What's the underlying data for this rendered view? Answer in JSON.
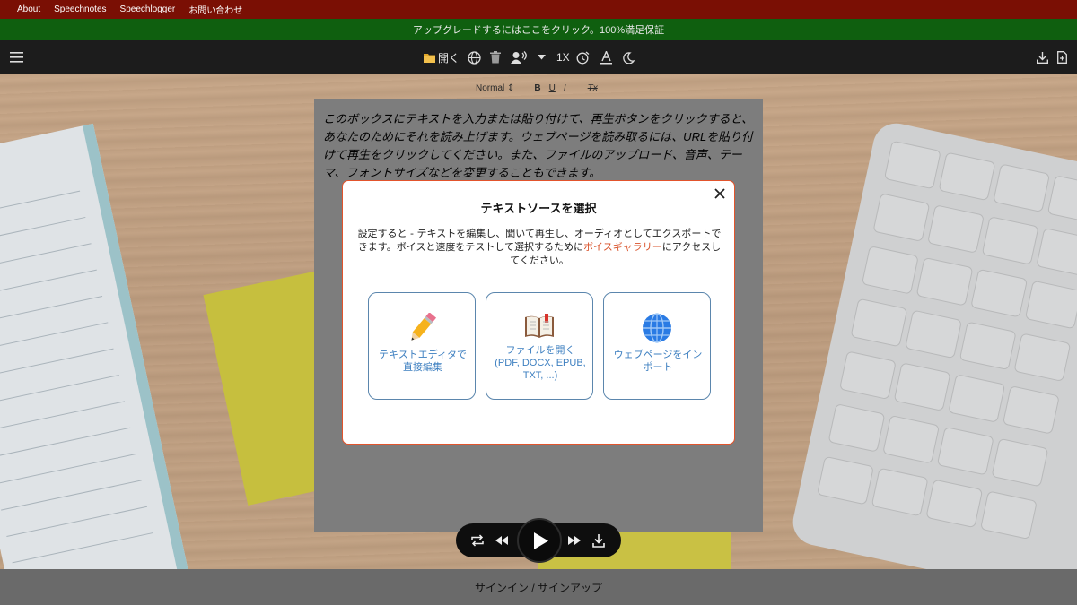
{
  "nav": {
    "links": [
      "About",
      "Speechnotes",
      "Speechlogger",
      "お問い合わせ"
    ]
  },
  "upgrade_banner": "アップグレードするにはここをクリック。100%満足保証",
  "toolbar": {
    "open_label": "開く",
    "speed_label": "1X",
    "icons": [
      "menu-icon",
      "folder-icon",
      "web-icon",
      "trash-icon",
      "voice-icon",
      "caret-down-icon",
      "timer-icon",
      "font-icon",
      "moon-icon",
      "download-icon",
      "export-file-icon"
    ]
  },
  "format_bar": {
    "style_select": "Normal",
    "bold": "B",
    "underline": "U",
    "italic": "I",
    "clear": "Tx"
  },
  "editor": {
    "text": "このボックスにテキストを入力または貼り付けて、再生ボタンをクリックすると、あなたのためにそれを読み上げます。ウェブページを読み取るには、URLを貼り付けて再生をクリックしてください。また、ファイルのアップロード、音声、テーマ、フォントサイズなどを変更することもできます。"
  },
  "modal": {
    "title": "テキストソースを選択",
    "desc_before": "設定すると - テキストを編集し、聞いて再生し、オーディオとしてエクスポートできます。ボイスと速度をテストして選択するために",
    "desc_link": "ボイスギャラリー",
    "desc_after": "にアクセスしてください。",
    "cards": [
      {
        "label": "テキストエディタで直接編集",
        "icon": "pencil-icon"
      },
      {
        "label": "ファイルを開く (PDF, DOCX, EPUB, TXT, ...)",
        "icon": "book-icon"
      },
      {
        "label": "ウェブページをインポート",
        "icon": "globe-icon"
      }
    ]
  },
  "player": {
    "icons": [
      "repeat-icon",
      "rewind-icon",
      "play-icon",
      "forward-icon",
      "download-icon"
    ]
  },
  "footer": {
    "signin": "サインイン / サインアップ"
  },
  "colors": {
    "nav_bg": "#7a0f04",
    "banner_bg": "#0f5f0f",
    "toolbar_bg": "#1c1c1c",
    "accent_link": "#d9532b",
    "card_border": "#5b86ad",
    "card_text": "#3d7fc0"
  }
}
